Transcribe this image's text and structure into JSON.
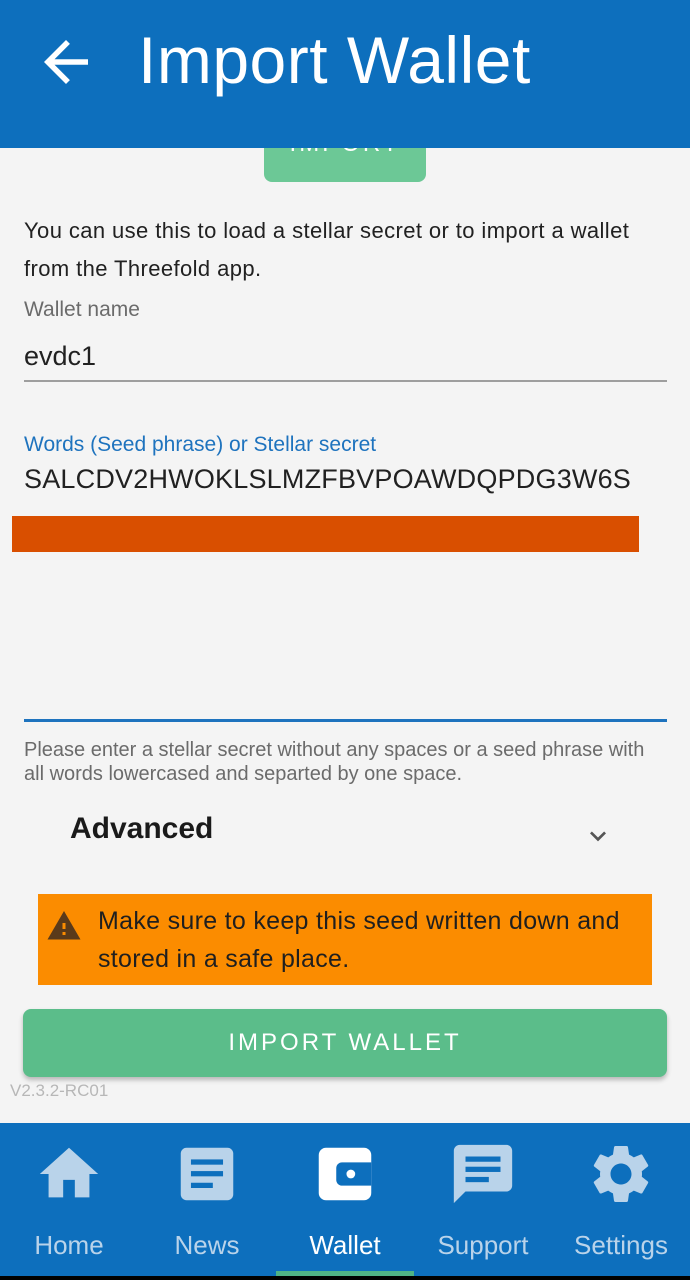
{
  "header": {
    "title": "Import Wallet",
    "back_icon": "arrow-left-icon"
  },
  "tabs": {
    "import_label": "IMPORT"
  },
  "intro_text": "You can use this to load a stellar secret or to import a wallet from the Threefold app.",
  "wallet_name": {
    "label": "Wallet name",
    "value": "evdc1"
  },
  "seed": {
    "label": "Words (Seed phrase) or Stellar secret",
    "value": "SALCDV2HWOKLSLMZFBVPOAWDQPDG3W6S"
  },
  "hint": "Please enter a stellar secret without any spaces or a seed phrase with all words lowercased and separted by one space.",
  "advanced": {
    "label": "Advanced",
    "icon": "chevron-down-icon"
  },
  "warning": {
    "text": "Make sure to keep this seed written down and stored in a safe place.",
    "icon": "warning-icon",
    "color": "#fb8c00"
  },
  "primary_button": {
    "label": "IMPORT WALLET",
    "color": "#5bbd8a"
  },
  "version": "V2.3.2-RC01",
  "bottom_nav": {
    "active": "Wallet",
    "items": [
      {
        "label": "Home",
        "icon": "home-icon"
      },
      {
        "label": "News",
        "icon": "news-icon"
      },
      {
        "label": "Wallet",
        "icon": "wallet-icon"
      },
      {
        "label": "Support",
        "icon": "chat-icon"
      },
      {
        "label": "Settings",
        "icon": "gear-icon"
      }
    ]
  },
  "colors": {
    "primary": "#0d6fbd",
    "accent": "#1e73be",
    "redaction": "#d94f00"
  }
}
